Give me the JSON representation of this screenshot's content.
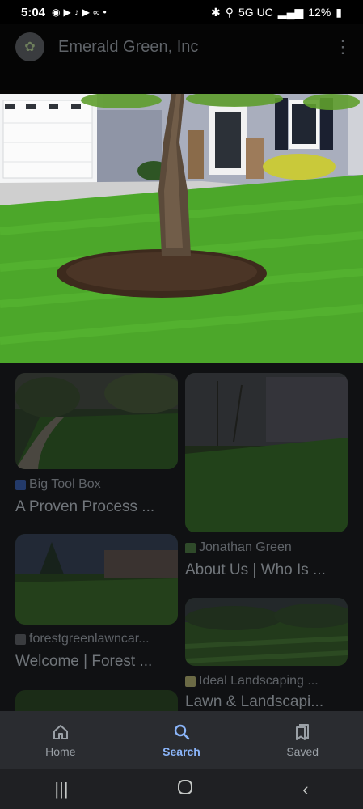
{
  "status": {
    "time": "5:04",
    "network": "5G UC",
    "battery": "12%"
  },
  "header": {
    "title": "Emerald Green, Inc"
  },
  "results": [
    {
      "source": "Big Tool Box",
      "title": "A Proven Process ..."
    },
    {
      "source": "Jonathan Green",
      "title": "About Us | Who Is ..."
    },
    {
      "source": "forestgreenlawncar...",
      "title": "Welcome | Forest ..."
    },
    {
      "source": "Ideal Landscaping ...",
      "title": "Lawn & Landscapi..."
    }
  ],
  "bottom_nav": [
    {
      "label": "Home",
      "icon": "home-icon"
    },
    {
      "label": "Search",
      "icon": "search-icon"
    },
    {
      "label": "Saved",
      "icon": "saved-icon"
    }
  ],
  "colors": {
    "accent": "#8ab4f8",
    "grass": "#4ca72a"
  }
}
